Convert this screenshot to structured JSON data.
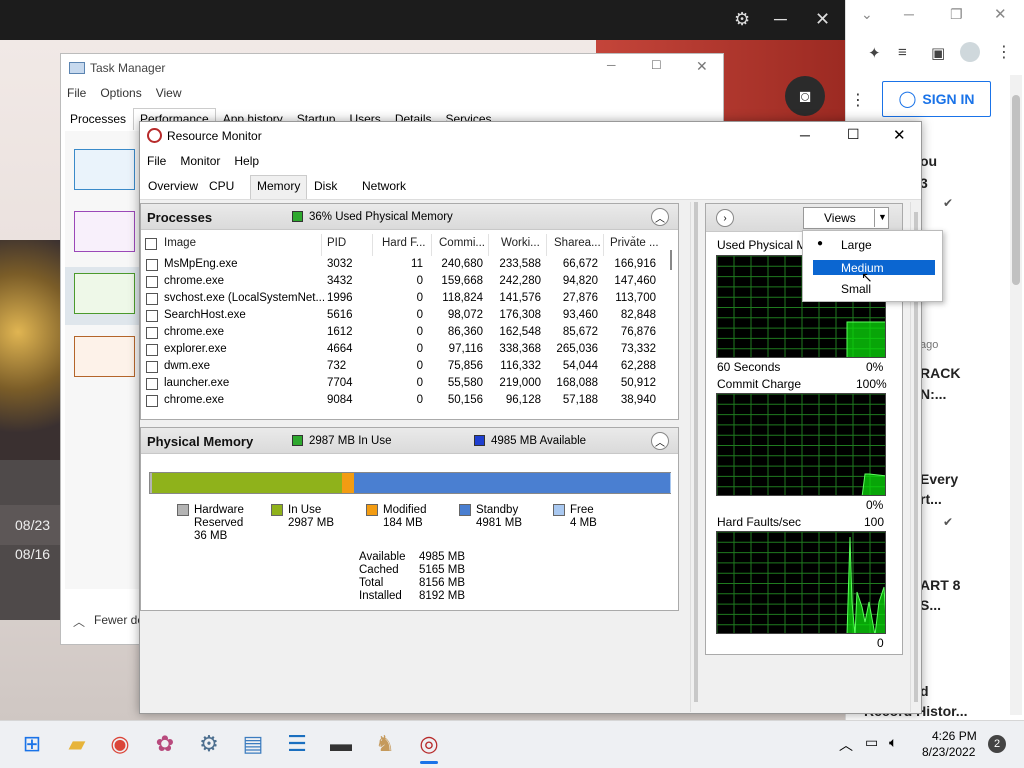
{
  "browser": {
    "signin": "SIGN IN",
    "right_texts": [
      "ou",
      "3",
      "rio",
      "ago",
      "RACK",
      "N:...",
      "Every",
      "rt...",
      "ART 8",
      "S...",
      "d",
      "Record Histor..."
    ],
    "dates": [
      "08/23",
      "08/16"
    ]
  },
  "task_manager": {
    "title": "Task Manager",
    "menu": [
      "File",
      "Options",
      "View"
    ],
    "tabs": [
      "Processes",
      "Performance",
      "App history",
      "Startup",
      "Users",
      "Details",
      "Services"
    ],
    "fewer_details": "Fewer de"
  },
  "resource_monitor": {
    "title": "Resource Monitor",
    "menu": [
      "File",
      "Monitor",
      "Help"
    ],
    "tabs": [
      "Overview",
      "CPU",
      "Memory",
      "Disk",
      "Network"
    ],
    "processes": {
      "title": "Processes",
      "status": "36% Used Physical Memory",
      "columns": [
        "Image",
        "PID",
        "Hard F...",
        "Commi...",
        "Worki...",
        "Sharea...",
        "Private ..."
      ],
      "rows": [
        [
          "MsMpEng.exe",
          "3032",
          "11",
          "240,680",
          "233,588",
          "66,672",
          "166,916"
        ],
        [
          "chrome.exe",
          "3432",
          "0",
          "159,668",
          "242,280",
          "94,820",
          "147,460"
        ],
        [
          "svchost.exe (LocalSystemNet...",
          "1996",
          "0",
          "118,824",
          "141,576",
          "27,876",
          "113,700"
        ],
        [
          "SearchHost.exe",
          "5616",
          "0",
          "98,072",
          "176,308",
          "93,460",
          "82,848"
        ],
        [
          "chrome.exe",
          "1612",
          "0",
          "86,360",
          "162,548",
          "85,672",
          "76,876"
        ],
        [
          "explorer.exe",
          "4664",
          "0",
          "97,116",
          "338,368",
          "265,036",
          "73,332"
        ],
        [
          "dwm.exe",
          "732",
          "0",
          "75,856",
          "116,332",
          "54,044",
          "62,288"
        ],
        [
          "launcher.exe",
          "7704",
          "0",
          "55,580",
          "219,000",
          "168,088",
          "50,912"
        ],
        [
          "chrome.exe",
          "9084",
          "0",
          "50,156",
          "96,128",
          "57,188",
          "38,940"
        ]
      ]
    },
    "physical_memory": {
      "title": "Physical Memory",
      "in_use": "2987 MB In Use",
      "available": "4985 MB Available",
      "bar": {
        "hardware_reserved_mb": 36,
        "in_use_mb": 2987,
        "modified_mb": 184,
        "standby_mb": 4981,
        "free_mb": 4
      },
      "legend": [
        {
          "name": "Hardware Reserved",
          "line1": "Hardware",
          "line2": "Reserved",
          "value": "36 MB",
          "color": "#b4b4b4"
        },
        {
          "name": "In Use",
          "line1": "In Use",
          "line2": "",
          "value": "2987 MB",
          "color": "#8fb21b"
        },
        {
          "name": "Modified",
          "line1": "Modified",
          "line2": "",
          "value": "184 MB",
          "color": "#f39c12"
        },
        {
          "name": "Standby",
          "line1": "Standby",
          "line2": "",
          "value": "4981 MB",
          "color": "#4a7fd1"
        },
        {
          "name": "Free",
          "line1": "Free",
          "line2": "",
          "value": "4 MB",
          "color": "#a9c8f0"
        }
      ],
      "stats": [
        {
          "label": "Available",
          "value": "4985 MB"
        },
        {
          "label": "Cached",
          "value": "5165 MB"
        },
        {
          "label": "Total",
          "value": "8156 MB"
        },
        {
          "label": "Installed",
          "value": "8192 MB"
        }
      ]
    },
    "graphs": {
      "views_label": "Views",
      "views_options": [
        "Large",
        "Medium",
        "Small"
      ],
      "views_selected": "Medium",
      "g1_title": "Used Physical M",
      "g1_bottom_left": "60 Seconds",
      "g1_bottom_right": "0%",
      "g2_title": "Commit Charge",
      "g2_top_right": "100%",
      "g2_bottom_right": "0%",
      "g3_title": "Hard Faults/sec",
      "g3_top_right": "100",
      "g3_bottom_right": "0"
    }
  },
  "clock": {
    "time": "4:26 PM",
    "date": "8/23/2022",
    "notif": "2"
  }
}
